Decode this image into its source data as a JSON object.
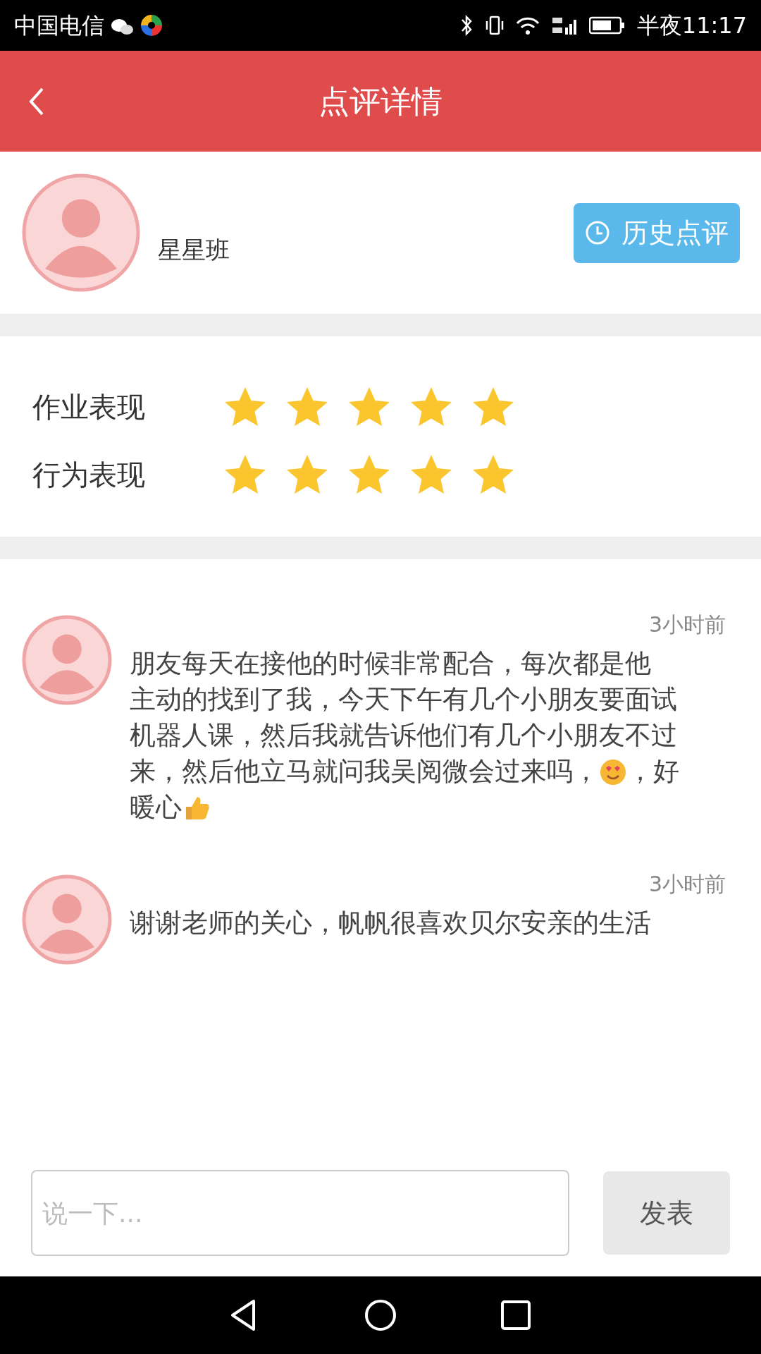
{
  "status_bar": {
    "carrier": "中国电信",
    "time": "半夜11:17"
  },
  "header": {
    "title": "点评详情"
  },
  "profile": {
    "class_name": "星星班",
    "history_button": "历史点评"
  },
  "ratings": [
    {
      "label": "作业表现",
      "stars": 5
    },
    {
      "label": "行为表现",
      "stars": 5
    }
  ],
  "comments": [
    {
      "time": "3小时前",
      "lines": [
        [
          {
            "kind": "text",
            "text": "朋友每天在接他的时候非常配合，每次都是他"
          }
        ],
        [
          {
            "kind": "text",
            "text": "主动的找到了我，今天下午有几个小朋友要面试"
          }
        ],
        [
          {
            "kind": "text",
            "text": "机器人课，然后我就告诉他们有几个小朋友不过"
          }
        ],
        [
          {
            "kind": "text",
            "text": "来，然后他立马就问我吴阅微会过来吗，"
          },
          {
            "kind": "heart-eyes"
          },
          {
            "kind": "text",
            "text": "，好"
          }
        ],
        [
          {
            "kind": "text",
            "text": "暖心"
          },
          {
            "kind": "thumbs-up"
          }
        ]
      ]
    },
    {
      "time": "3小时前",
      "lines": [
        [
          {
            "kind": "text",
            "text": "谢谢老师的关心，帆帆很喜欢贝尔安亲的生活"
          }
        ]
      ]
    }
  ],
  "composer": {
    "placeholder": "说一下...",
    "send_button": "发表"
  }
}
